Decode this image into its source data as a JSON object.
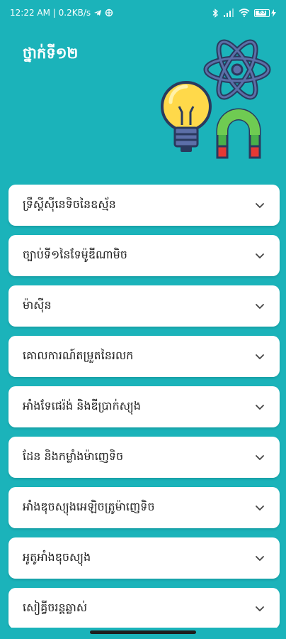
{
  "status_bar": {
    "time_speed": "12:22 AM | 0.2KB/s",
    "battery": "83"
  },
  "header": {
    "title": "ថ្នាក់ទី១២"
  },
  "illustration": {
    "icons": [
      "lightbulb-icon",
      "atom-icon",
      "magnet-icon"
    ]
  },
  "topics": [
    {
      "label": "ទ្រឹស្តីស៊ីនេទិចនៃឧស្ម័ន",
      "icon": "chevron-down-icon"
    },
    {
      "label": "ច្បាប់ទី១នៃទែម៉ូឌីណាមិច",
      "icon": "chevron-down-icon"
    },
    {
      "label": "ម៉ាស៊ីន",
      "icon": "chevron-down-icon"
    },
    {
      "label": "គោលការណ៍តម្រួតនៃរលក",
      "icon": "chevron-down-icon"
    },
    {
      "label": "អាំងទែផេរ៉ង់ និងឌីប្រាក់ស្យុង",
      "icon": "chevron-down-icon"
    },
    {
      "label": "ដែន និងកម្លាំងម៉ាញេទិច",
      "icon": "chevron-down-icon"
    },
    {
      "label": "អាំងឌុចស្យុងអេឡិចត្រូម៉ាញេទិច",
      "icon": "chevron-down-icon"
    },
    {
      "label": "អូតូអាំងឌុចស្យុង",
      "icon": "chevron-down-icon"
    },
    {
      "label": "សៀគ្វីចរន្តឆ្លាស់",
      "icon": "chevron-down-icon"
    }
  ],
  "colors": {
    "background": "#1BB3BA",
    "card": "#FFFFFF",
    "text": "#222222"
  }
}
